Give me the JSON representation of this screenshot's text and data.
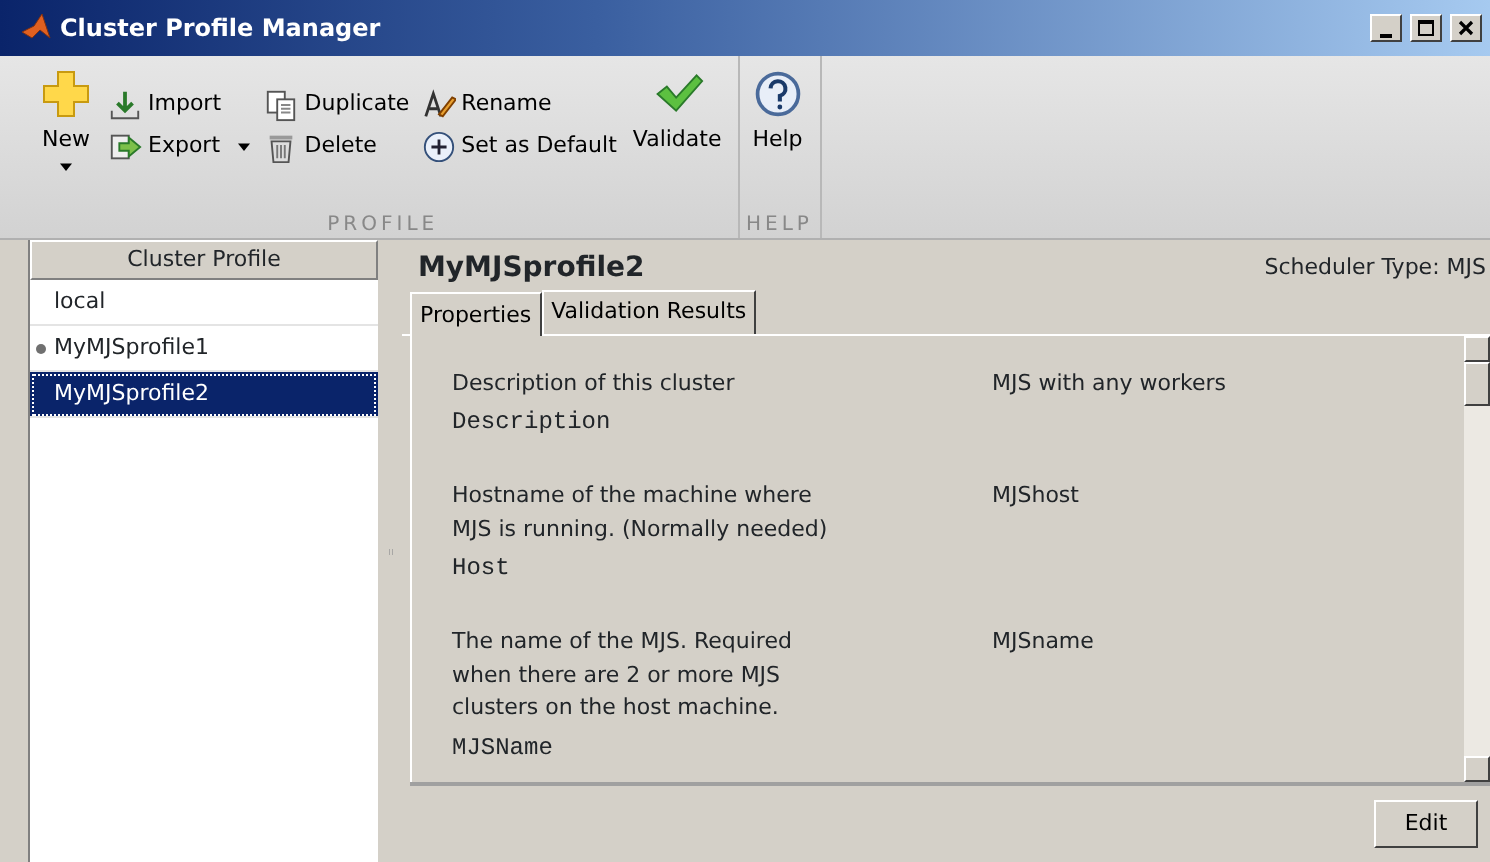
{
  "window": {
    "title": "Cluster Profile Manager"
  },
  "toolbar": {
    "sections": [
      {
        "label": "PROFILE",
        "groups": [
          {
            "kind": "large",
            "items": [
              {
                "label": "New",
                "dropdown": true
              }
            ]
          },
          {
            "kind": "small",
            "items": [
              {
                "label": "Import"
              },
              {
                "label": "Export",
                "dropdown": true
              }
            ]
          },
          {
            "kind": "small",
            "items": [
              {
                "label": "Duplicate"
              },
              {
                "label": "Delete"
              }
            ]
          },
          {
            "kind": "small",
            "items": [
              {
                "label": "Rename"
              },
              {
                "label": "Set as Default"
              }
            ]
          },
          {
            "kind": "large",
            "items": [
              {
                "label": "Validate"
              }
            ]
          }
        ]
      },
      {
        "label": "HELP",
        "groups": [
          {
            "kind": "large",
            "items": [
              {
                "label": "Help"
              }
            ]
          }
        ]
      }
    ]
  },
  "profiles": {
    "header": "Cluster Profile",
    "items": [
      {
        "name": "local",
        "default": false,
        "selected": false
      },
      {
        "name": "MyMJSprofile1",
        "default": true,
        "selected": false
      },
      {
        "name": "MyMJSprofile2",
        "default": false,
        "selected": true
      }
    ]
  },
  "detail": {
    "title": "MyMJSprofile2",
    "scheduler_type": "Scheduler Type: MJS",
    "tabs": [
      {
        "label": "Properties",
        "selected": true
      },
      {
        "label": "Validation Results",
        "selected": false
      }
    ],
    "properties": [
      {
        "description": "Description of this cluster",
        "name": "Description",
        "value": "MJS with any workers"
      },
      {
        "description": "Hostname of the machine where MJS is running. (Normally needed)",
        "name": "Host",
        "value": "MJShost"
      },
      {
        "description": "The name of the MJS. Required when there are 2 or more MJS clusters on the host machine.",
        "name": "MJSName",
        "value": "MJSname"
      }
    ],
    "edit_button": "Edit"
  }
}
